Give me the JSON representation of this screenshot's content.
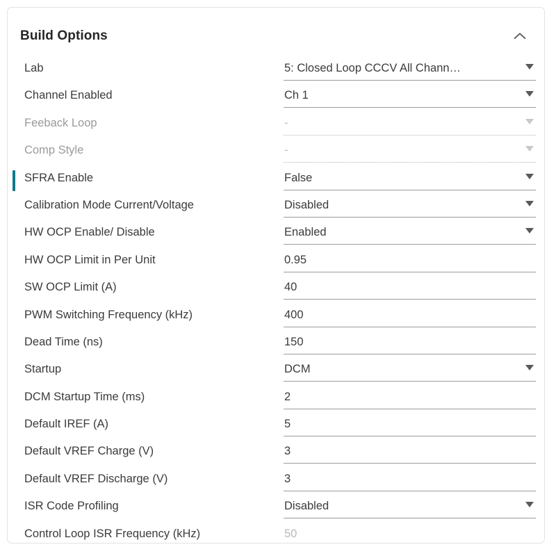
{
  "panel": {
    "title": "Build Options",
    "collapse_icon": "chevron-up-icon",
    "accent_color": "#0f7b8a",
    "border_color": "#e2e2e2"
  },
  "rows": [
    {
      "label": "Lab",
      "value": "5: Closed Loop CCCV All Chann…",
      "control": "dropdown",
      "state": "enabled",
      "selected": false
    },
    {
      "label": "Channel Enabled",
      "value": "Ch 1",
      "control": "dropdown",
      "state": "enabled",
      "selected": false
    },
    {
      "label": "Feeback Loop",
      "value": "-",
      "control": "dropdown",
      "state": "disabled",
      "selected": false
    },
    {
      "label": "Comp Style",
      "value": "-",
      "control": "dropdown",
      "state": "disabled",
      "selected": false
    },
    {
      "label": "SFRA Enable",
      "value": "False",
      "control": "dropdown",
      "state": "enabled",
      "selected": true
    },
    {
      "label": "Calibration Mode Current/Voltage",
      "value": "Disabled",
      "control": "dropdown",
      "state": "enabled",
      "selected": false
    },
    {
      "label": "HW OCP Enable/ Disable",
      "value": "Enabled",
      "control": "dropdown",
      "state": "enabled",
      "selected": false
    },
    {
      "label": "HW OCP Limit in Per Unit",
      "value": "0.95",
      "control": "text",
      "state": "enabled",
      "selected": false
    },
    {
      "label": "SW OCP Limit (A)",
      "value": "40",
      "control": "text",
      "state": "enabled",
      "selected": false
    },
    {
      "label": "PWM Switching Frequency (kHz)",
      "value": "400",
      "control": "text",
      "state": "enabled",
      "selected": false
    },
    {
      "label": "Dead Time (ns)",
      "value": "150",
      "control": "text",
      "state": "enabled",
      "selected": false
    },
    {
      "label": "Startup",
      "value": "DCM",
      "control": "dropdown",
      "state": "enabled",
      "selected": false
    },
    {
      "label": "DCM Startup Time (ms)",
      "value": "2",
      "control": "text",
      "state": "enabled",
      "selected": false
    },
    {
      "label": "Default IREF (A)",
      "value": "5",
      "control": "text",
      "state": "enabled",
      "selected": false
    },
    {
      "label": "Default VREF Charge (V)",
      "value": "3",
      "control": "text",
      "state": "enabled",
      "selected": false
    },
    {
      "label": "Default VREF Discharge (V)",
      "value": "3",
      "control": "text",
      "state": "enabled",
      "selected": false
    },
    {
      "label": "ISR Code Profiling",
      "value": "Disabled",
      "control": "dropdown",
      "state": "enabled",
      "selected": false
    },
    {
      "label": "Control Loop ISR Frequency (kHz)",
      "value": "50",
      "control": "text",
      "state": "readonly",
      "selected": false
    }
  ]
}
